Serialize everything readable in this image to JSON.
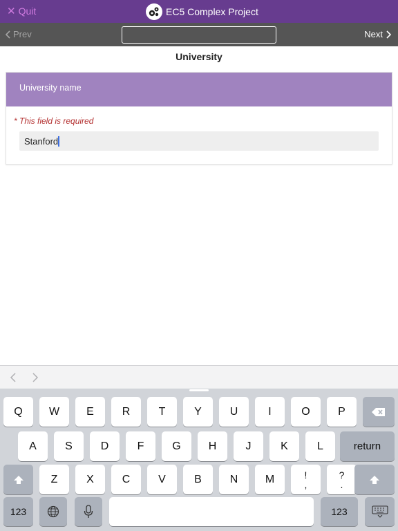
{
  "header": {
    "quit_label": "Quit",
    "title": "EC5 Complex Project"
  },
  "nav": {
    "prev_label": "Prev",
    "next_label": "Next",
    "jump_value": ""
  },
  "page": {
    "title": "University"
  },
  "question": {
    "label": "University name",
    "required_text": "* This field is required",
    "value": "Stanford"
  },
  "keyboard": {
    "row1": [
      "Q",
      "W",
      "E",
      "R",
      "T",
      "Y",
      "U",
      "I",
      "O",
      "P"
    ],
    "row2": [
      "A",
      "S",
      "D",
      "F",
      "G",
      "H",
      "J",
      "K",
      "L"
    ],
    "row3": [
      "Z",
      "X",
      "C",
      "V",
      "B",
      "N",
      "M"
    ],
    "exclaim_top": "!",
    "exclaim_bottom": ",",
    "question_top": "?",
    "question_bottom": ".",
    "return_label": "return",
    "numbers_label": "123",
    "numbers_label_right": "123"
  },
  "colors": {
    "header_bg": "#673c8f",
    "card_header_bg": "#a083bf",
    "required": "#b32f2f"
  },
  "icons": [
    "close-icon",
    "gear-logo-icon",
    "chevron-left-icon",
    "chevron-right-icon",
    "backspace-icon",
    "shift-icon",
    "globe-icon",
    "microphone-icon",
    "keyboard-dismiss-icon"
  ]
}
